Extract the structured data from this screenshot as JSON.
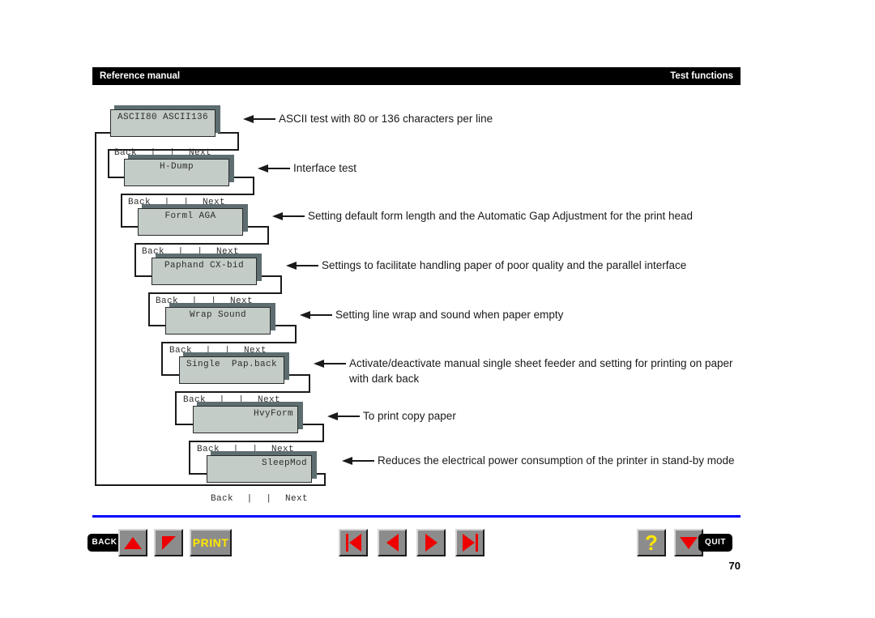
{
  "header": {
    "left_title": "Reference manual",
    "right_title": "Test functions",
    "bar_color": "#000000"
  },
  "colors": {
    "lcd_panel": "#c3ccc7",
    "lcd_shadow": "#5e6e70",
    "rule_blue": "#0000ff",
    "accent_red": "#ee0000",
    "accent_yellow": "#ffe800",
    "button_face": "#8c8c8c"
  },
  "diagram": {
    "menu_back_label": "Back",
    "menu_next_label": "Next",
    "menu_separator": "|",
    "nodes": [
      {
        "id": "ascii",
        "display": "ASCII80 ASCII136",
        "align": "center",
        "back": "Back",
        "next": "Next",
        "description": "ASCII test with 80 or 136 characters per line"
      },
      {
        "id": "hdump",
        "display": "H-Dump",
        "align": "center",
        "back": "Back",
        "next": "Next",
        "description": "Interface test"
      },
      {
        "id": "forml-aga",
        "display": "Forml AGA",
        "align": "center",
        "back": "Back",
        "next": "Next",
        "description": "Setting default form length and the Automatic Gap Adjustment for the print head"
      },
      {
        "id": "paphand-cxbid",
        "display": "Paphand CX-bid",
        "align": "center",
        "back": "Back",
        "next": "Next",
        "description": "Settings to facilitate handling paper of poor quality and the parallel interface"
      },
      {
        "id": "wrap-sound",
        "display": "Wrap Sound",
        "align": "center",
        "back": "Back",
        "next": "Next",
        "description": "Setting line wrap and sound when paper empty"
      },
      {
        "id": "single-papback",
        "display": "Single  Pap.back",
        "align": "center",
        "back": "Back",
        "next": "Next",
        "description": "Activate/deactivate manual single sheet feeder and setting for printing on paper with dark back"
      },
      {
        "id": "hvyform",
        "display": "HvyForm",
        "align": "right",
        "back": "Back",
        "next": "Next",
        "description": "To print copy paper"
      },
      {
        "id": "sleepmod",
        "display": "SleepMod",
        "align": "right",
        "back": "Back",
        "next": "Next",
        "description": "Reduces the electrical power consumption of the printer in stand-by mode"
      }
    ]
  },
  "toolbar": {
    "back_label": "BACK",
    "quit_label": "QUIT",
    "print_label": "PRINT",
    "help_label": "?",
    "icons": {
      "page_up": "triangle-up-icon",
      "page_down": "triangle-corner-icon",
      "first_page": "skip-first-icon",
      "previous_page": "triangle-left-icon",
      "next_page": "triangle-right-icon",
      "last_page": "skip-last-icon",
      "quit_arrow": "triangle-down-icon"
    }
  },
  "footer": {
    "page_number": "70"
  }
}
